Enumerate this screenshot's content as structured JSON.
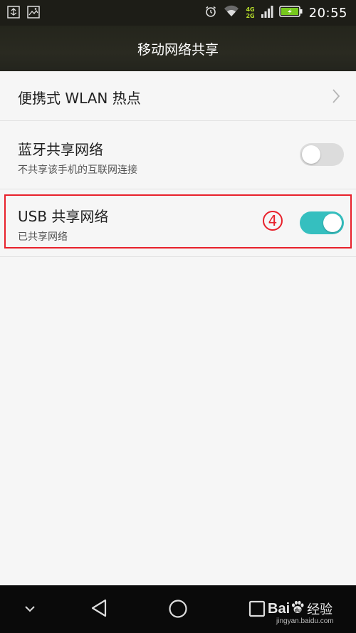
{
  "status_bar": {
    "time": "20:55",
    "network_top": "4G",
    "network_bottom": "2G",
    "left_icons": [
      "usb-debug-icon",
      "screenshot-icon"
    ],
    "right_icons": [
      "alarm-icon",
      "wifi-icon",
      "signal-icon",
      "battery-charging-icon"
    ]
  },
  "header": {
    "title": "移动网络共享"
  },
  "rows": [
    {
      "title": "便携式 WLAN 热点",
      "subtitle": "",
      "control": "chevron"
    },
    {
      "title": "蓝牙共享网络",
      "subtitle": "不共享该手机的互联网连接",
      "control": "toggle",
      "enabled": false
    },
    {
      "title": "USB 共享网络",
      "subtitle": "已共享网络",
      "control": "toggle",
      "enabled": true
    }
  ],
  "annotation": {
    "number": "4",
    "color": "#e8212b"
  },
  "nav_bar": {
    "buttons": [
      "collapse-icon",
      "back-icon",
      "home-icon",
      "recents-icon"
    ]
  },
  "watermark": {
    "brand": "Bai",
    "brand_suffix": "经验",
    "url": "jingyan.baidu.com"
  },
  "colors": {
    "accent": "#35bfbf",
    "toggle_off": "#dcdcdc",
    "annotation": "#e8212b",
    "status_bar": "#1d1d17"
  }
}
